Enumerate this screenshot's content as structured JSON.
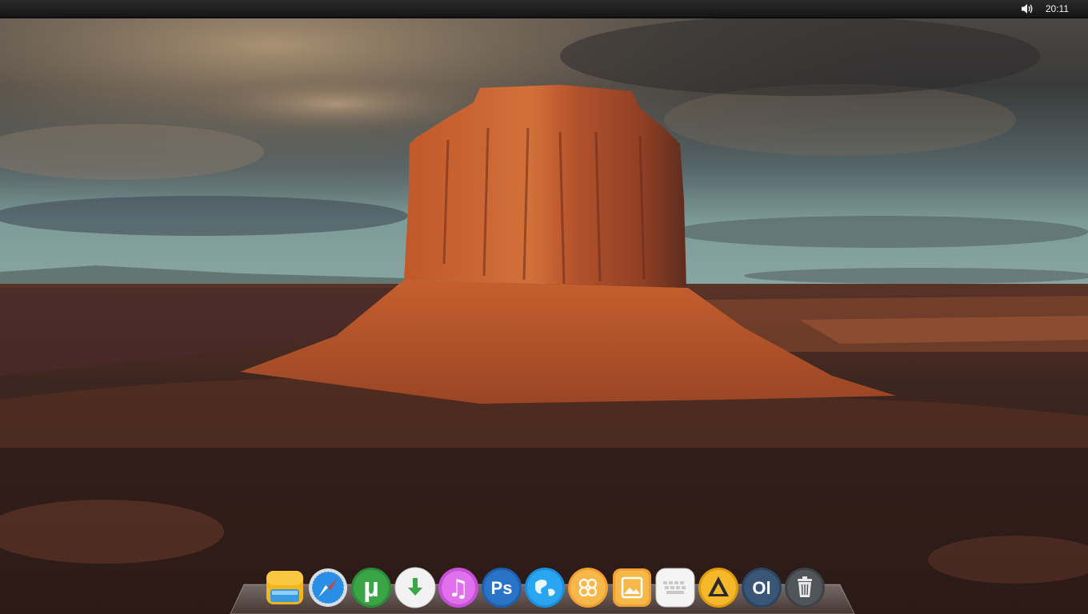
{
  "topbar": {
    "clock": "20:11",
    "volume_icon": "speaker-volume-icon"
  },
  "dock": {
    "items": [
      {
        "name": "finder-icon",
        "glyph": ""
      },
      {
        "name": "safari-compass-icon",
        "glyph": ""
      },
      {
        "name": "utorrent-icon",
        "glyph": "µ"
      },
      {
        "name": "download-arrow-icon",
        "glyph": ""
      },
      {
        "name": "itunes-music-icon",
        "glyph": "♫"
      },
      {
        "name": "photoshop-icon",
        "glyph": "Ps"
      },
      {
        "name": "internet-globe-icon",
        "glyph": ""
      },
      {
        "name": "flower-folder-icon",
        "glyph": ""
      },
      {
        "name": "image-viewer-icon",
        "glyph": ""
      },
      {
        "name": "keyboard-icon",
        "glyph": ""
      },
      {
        "name": "aimp-player-icon",
        "glyph": ""
      },
      {
        "name": "ol-app-icon",
        "glyph": "Ol"
      },
      {
        "name": "trash-icon",
        "glyph": ""
      }
    ]
  },
  "colors": {
    "topbar": "#1e1e1e",
    "sky_dark": "#3a3836",
    "butte_orange": "#c8632a",
    "ground": "#3a2620"
  }
}
